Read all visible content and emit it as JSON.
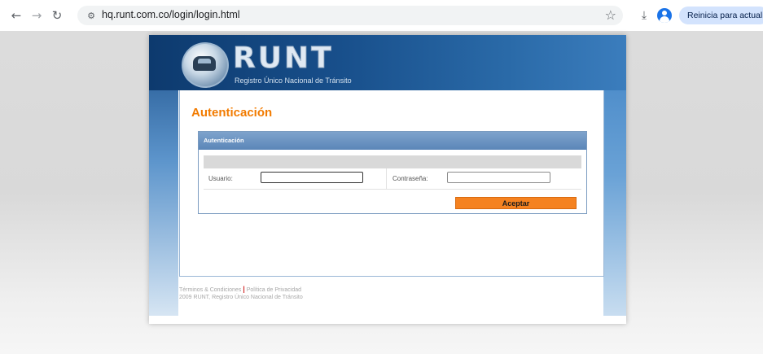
{
  "browser": {
    "url": "hq.runt.com.co/login/login.html",
    "update_button": "Reinicia para actualizar",
    "icons": [
      "back-icon",
      "forward-icon",
      "reload-icon",
      "site-settings-icon",
      "star-icon",
      "download-icon",
      "profile-icon"
    ]
  },
  "brand": {
    "name": "RUNT",
    "subtitle": "Registro Único Nacional de Tránsito"
  },
  "login": {
    "page_title": "Autenticación",
    "panel_title": "Autenticación",
    "user_label": "Usuario:",
    "user_value": "",
    "password_label": "Contraseña:",
    "password_value": "",
    "submit_label": "Aceptar"
  },
  "footer": {
    "terms": "Términos & Condiciones",
    "privacy": "Política de Privacidad",
    "copyright": "2009 RUNT, Registro Único Nacional de Tránsito"
  },
  "colors": {
    "accent_orange": "#f27b00",
    "header_blue": "#5b86b8",
    "button_orange": "#f58220"
  }
}
